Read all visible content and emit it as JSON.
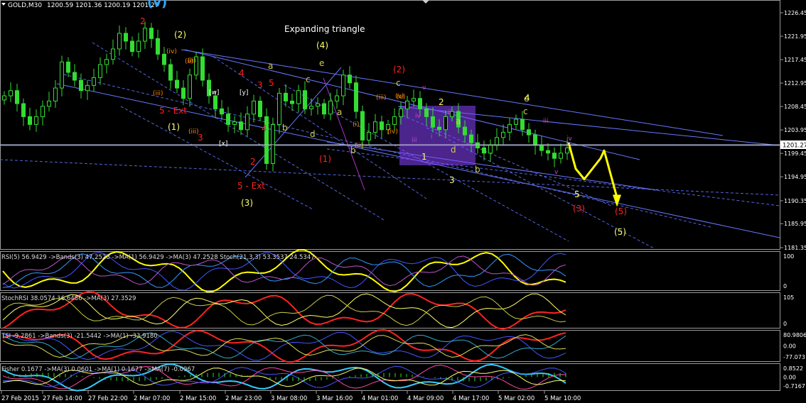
{
  "header": {
    "symbol_label": "GOLD,M30",
    "ohlc": "1200.59 1201.36 1200.19 1201.27",
    "big_wave_label": "(v)"
  },
  "price_axis": {
    "ticks": [
      "1226.45",
      "1221.95",
      "1217.45",
      "1212.95",
      "1208.45",
      "1203.95",
      "1199.45",
      "1194.95",
      "1190.35",
      "1185.95",
      "1181.35"
    ],
    "current": "1201.27"
  },
  "time_axis": {
    "ticks": [
      "27 Feb 2015",
      "27 Feb 14:00",
      "27 Feb 22:00",
      "2 Mar 07:00",
      "2 Mar 15:00",
      "2 Mar 23:00",
      "3 Mar 08:00",
      "3 Mar 16:00",
      "4 Mar 01:00",
      "4 Mar 09:00",
      "4 Mar 17:00",
      "5 Mar 02:00",
      "5 Mar 10:00"
    ]
  },
  "main_title": "Expanding triangle",
  "wave_labels": [
    {
      "t": "(4)",
      "c": "#ffff66"
    },
    {
      "t": "(2)",
      "c": "#ffff66"
    },
    {
      "t": "(1)",
      "c": "#ffff66"
    },
    {
      "t": "(3)",
      "c": "#ffff66"
    },
    {
      "t": "(5)",
      "c": "#ffff66"
    },
    {
      "t": "2",
      "c": "#ff2222"
    },
    {
      "t": "4",
      "c": "#ff2222"
    },
    {
      "t": "3",
      "c": "#ff2222"
    },
    {
      "t": "5",
      "c": "#ff2222"
    },
    {
      "t": "4",
      "c": "#ff2222"
    },
    {
      "t": "2",
      "c": "#ff2222"
    },
    {
      "t": "3",
      "c": "#ff2222"
    },
    {
      "t": "5 - Ext",
      "c": "#ff2222"
    },
    {
      "t": "5 - Ext",
      "c": "#ff2222"
    },
    {
      "t": "(1)",
      "c": "#ff2222"
    },
    {
      "t": "(2)",
      "c": "#ff2222"
    },
    {
      "t": "(3)",
      "c": "#ff2222"
    },
    {
      "t": "(5)",
      "c": "#ff2222"
    },
    {
      "t": "a",
      "c": "#cccc55"
    },
    {
      "t": "b",
      "c": "#cccc55"
    },
    {
      "t": "c",
      "c": "#cccc55"
    },
    {
      "t": "d",
      "c": "#cccc55"
    },
    {
      "t": "e",
      "c": "#cccc55"
    },
    {
      "t": "a",
      "c": "#cccc55"
    },
    {
      "t": "b",
      "c": "#cccc55"
    },
    {
      "t": "c",
      "c": "#cccc55"
    },
    {
      "t": "d",
      "c": "#cccc55"
    },
    {
      "t": "c",
      "c": "#cccc55"
    },
    {
      "t": "a",
      "c": "#cccc55"
    },
    {
      "t": "b",
      "c": "#cccc55"
    },
    {
      "t": "c",
      "c": "#cccc55"
    },
    {
      "t": "1",
      "c": "#ffff66"
    },
    {
      "t": "2",
      "c": "#ffff66"
    },
    {
      "t": "3",
      "c": "#ffff66"
    },
    {
      "t": "4",
      "c": "#ffff66"
    },
    {
      "t": "5",
      "c": "#ffff66"
    },
    {
      "t": "(ii)",
      "c": "#ff8800"
    },
    {
      "t": "(iii)",
      "c": "#ff8800"
    },
    {
      "t": "(iv)",
      "c": "#ff8800"
    },
    {
      "t": "(v)",
      "c": "#ff8800"
    },
    {
      "t": "(i)",
      "c": "#ff8800"
    },
    {
      "t": "(ii)",
      "c": "#ff8800"
    },
    {
      "t": "(iii)",
      "c": "#ff8800"
    },
    {
      "t": "(iv)",
      "c": "#ff8800"
    },
    {
      "t": "(v)",
      "c": "#ff8800"
    },
    {
      "t": "(ii)",
      "c": "#ff8800"
    },
    {
      "t": "(iii)",
      "c": "#ff8800"
    },
    {
      "t": "[w]",
      "c": "#ffffff"
    },
    {
      "t": "[x]",
      "c": "#ffffff"
    },
    {
      "t": "[y]",
      "c": "#ffffff"
    },
    {
      "t": "iii",
      "c": "#cc44cc"
    },
    {
      "t": "iv",
      "c": "#cc44cc"
    },
    {
      "t": "v",
      "c": "#cc44cc"
    },
    {
      "t": "ii",
      "c": "#cc44cc"
    },
    {
      "t": "i",
      "c": "#cc44cc"
    },
    {
      "t": "iii",
      "c": "#cc44cc"
    },
    {
      "t": "iv",
      "c": "#cc44cc"
    },
    {
      "t": "v",
      "c": "#cc44cc"
    }
  ],
  "indicators": [
    {
      "label": "RSI(5) 56.9429 ->Bands(3) 47.2528 ->MA(1) 56.9429 ->MA(3) 47.2528 Stoch(21,3,3) 53.3537 24.5347",
      "scale": [
        "100",
        "0"
      ]
    },
    {
      "label": "StochRSI 38.0574 16.6486 ->MA(3) 27.3529",
      "scale": [
        "105",
        "0"
      ]
    },
    {
      "label": "TSI -9.2861 ->Bands(3) -21.5442 ->MA(1) -33.9180",
      "scale": [
        "80.9806",
        "0.00",
        "-77.073"
      ]
    },
    {
      "label": "Fisher 0.1677 ->MA(3) 0.0601 ->MA(1) 0.1677 ->MA(7) -0.0967",
      "scale": [
        "0.8522",
        "0.00",
        "-0.7167"
      ]
    }
  ],
  "colors": {
    "bull": "#33dd33",
    "bear": "#33dd33",
    "trend": "#6677ff",
    "box": "#8844ff",
    "arrow": "#ffff00",
    "rsi": "#ffff00",
    "stoch": "#ff2222"
  },
  "chart_data": {
    "type": "line",
    "title": "Expanding triangle",
    "series": [
      {
        "name": "GOLD,M30",
        "values": [
          1210.5,
          1211.5,
          1209.0,
          1206.5,
          1205.0,
          1206.5,
          1208.5,
          1209.5,
          1212.0,
          1217.0,
          1215.0,
          1213.5,
          1211.5,
          1212.5,
          1214.0,
          1216.5,
          1217.5,
          1219.5,
          1222.5,
          1221.0,
          1219.0,
          1221.0,
          1223.5,
          1221.5,
          1218.5,
          1216.5,
          1213.5,
          1212.0,
          1210.0,
          1214.5,
          1218.0,
          1213.5,
          1210.5,
          1208.0,
          1207.0,
          1205.0,
          1205.5,
          1204.0,
          1207.0,
          1209.5,
          1206.5,
          1197.5,
          1205.0,
          1211.0,
          1209.5,
          1209.0,
          1211.5,
          1208.0,
          1208.5,
          1209.0,
          1207.0,
          1209.5,
          1210.5,
          1214.5,
          1213.0,
          1207.5,
          1202.0,
          1203.5,
          1205.5,
          1204.0,
          1205.0,
          1206.5,
          1208.0,
          1209.5,
          1210.0,
          1208.0,
          1206.5,
          1204.5,
          1204.0,
          1206.5,
          1207.5,
          1204.5,
          1203.0,
          1201.5,
          1200.5,
          1199.5,
          1201.0,
          1202.5,
          1203.5,
          1205.0,
          1206.0,
          1204.0,
          1203.0,
          1201.0,
          1200.0,
          1199.5,
          1198.5,
          1199.5,
          1200.5
        ]
      }
    ],
    "y_range": [
      1181.35,
      1226.45
    ],
    "ylim_ticks": [
      1226.45,
      1221.95,
      1217.45,
      1212.95,
      1208.45,
      1203.95,
      1199.45,
      1194.95,
      1190.35,
      1185.95,
      1181.35
    ],
    "categories": [
      "27 Feb 2015",
      "27 Feb 14:00",
      "27 Feb 22:00",
      "2 Mar 07:00",
      "2 Mar 15:00",
      "2 Mar 23:00",
      "3 Mar 08:00",
      "3 Mar 16:00",
      "4 Mar 01:00",
      "4 Mar 09:00",
      "4 Mar 17:00",
      "5 Mar 02:00",
      "5 Mar 10:00"
    ],
    "projection": [
      1201.5,
      1196.5,
      1194.5,
      1198.5,
      1200.0,
      1191.0
    ],
    "current_price": 1201.27,
    "grid": false
  }
}
